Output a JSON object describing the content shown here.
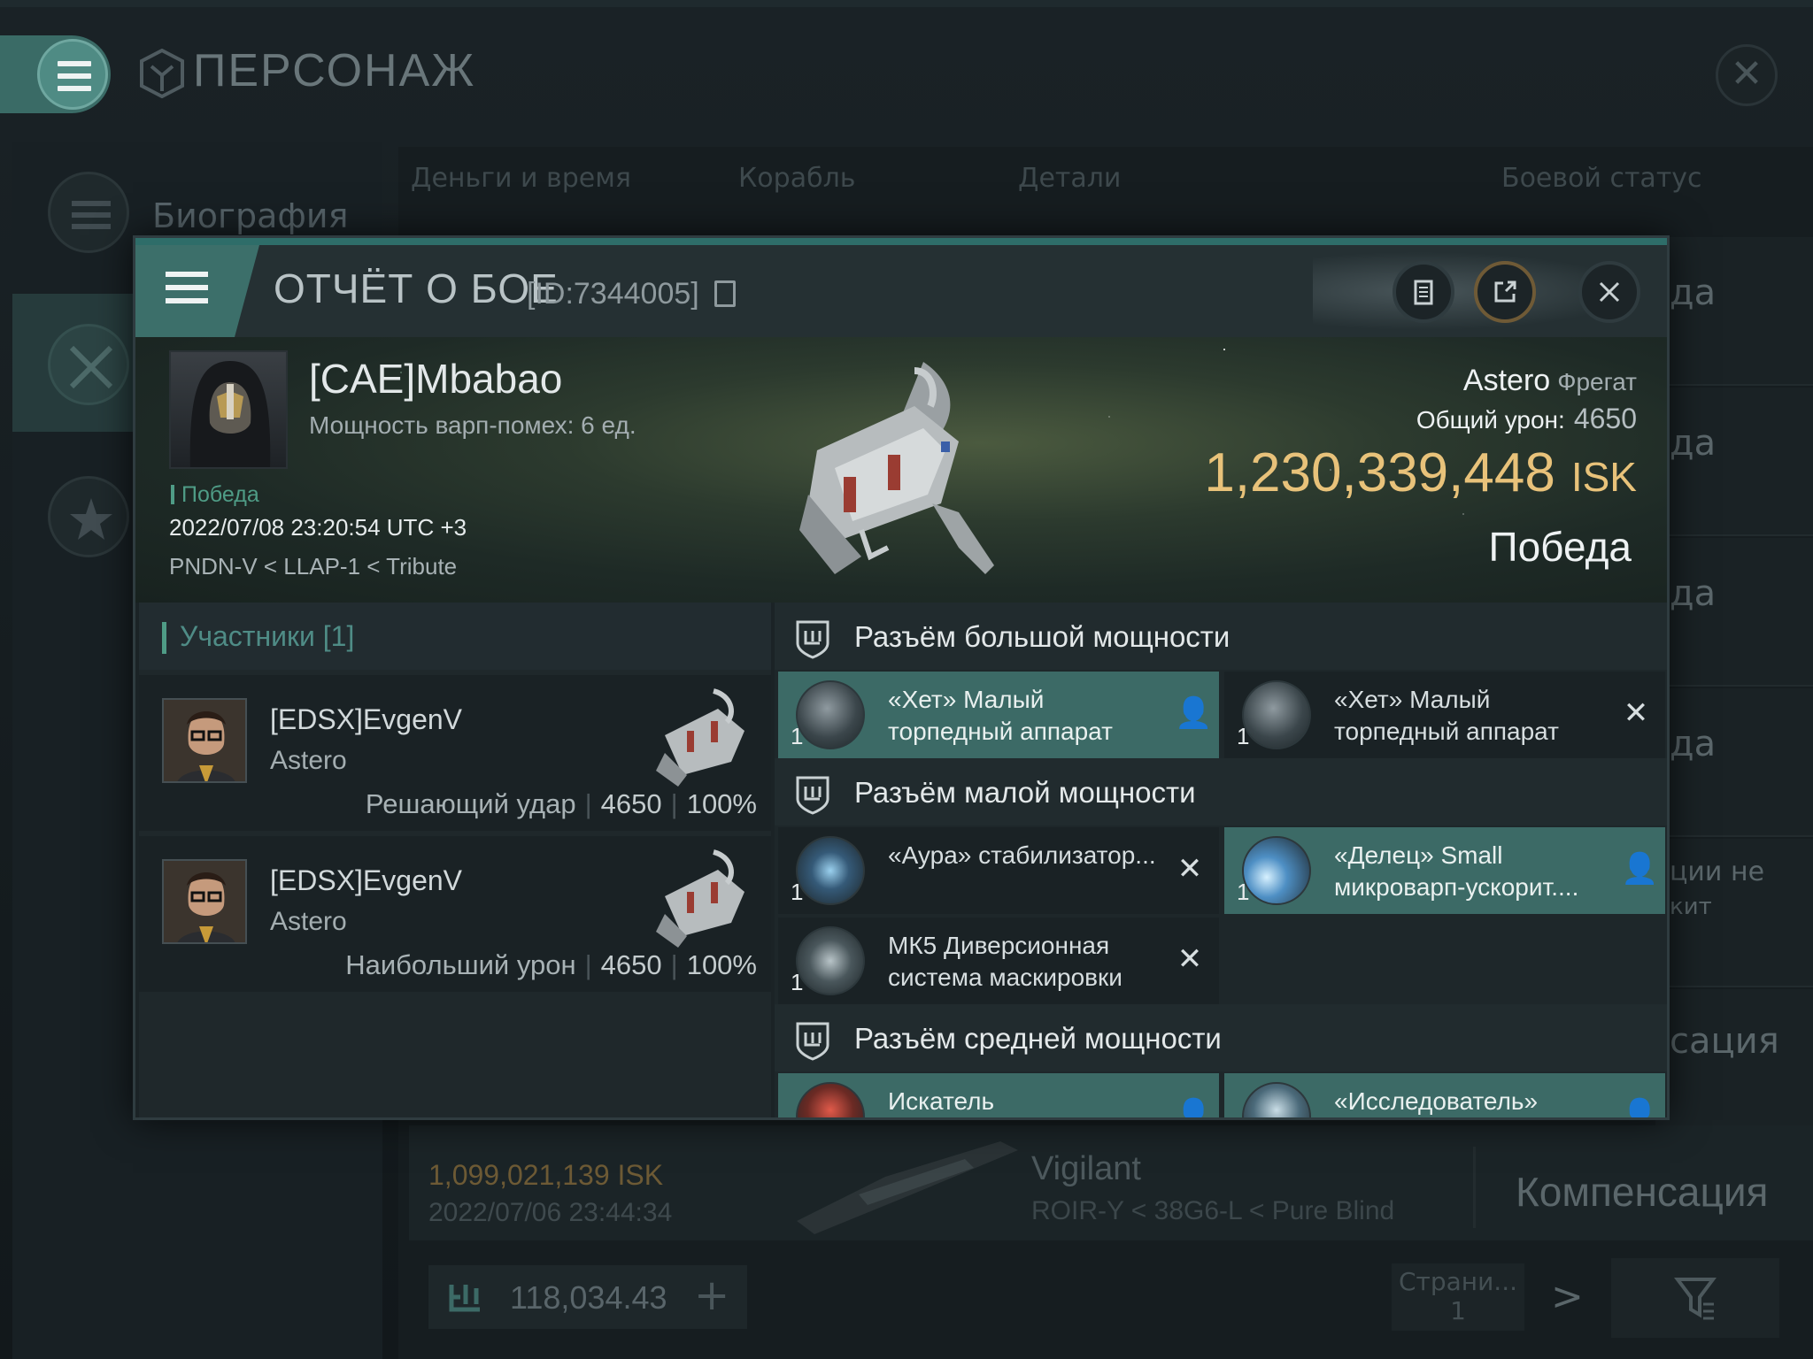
{
  "background": {
    "page_title": "ПЕРСОНАЖ",
    "sidebar": {
      "items": [
        {
          "label": "Биография",
          "icon": "list-icon",
          "active": false
        },
        {
          "label": "",
          "icon": "crossed-swords-icon",
          "active": true
        },
        {
          "label": "",
          "icon": "star-icon",
          "active": false
        }
      ]
    },
    "tabs": [
      "Деньги и время",
      "Корабль",
      "Детали",
      "Боевой статус"
    ],
    "right_fragments": [
      "да",
      "да",
      "да",
      "да",
      "ции не",
      "кит",
      "сация"
    ],
    "kill_row": {
      "isk": "1,099,021,139  ISK",
      "date": "2022/07/06  23:44:34",
      "ship": "Vigilant",
      "location": "ROIR-Y < 38G6-L < Pure Blind",
      "action": "Компенсация"
    },
    "wallet": {
      "value": "118,034.43",
      "plus": "+"
    },
    "pager": {
      "label": "Страни...",
      "page": "1",
      "next": ">"
    }
  },
  "dialog": {
    "title": "ОТЧЁТ О БОЕ",
    "id_text": "[ID:7344005]",
    "victim": {
      "name": "[CAE]Mbabao",
      "warp": "Мощность варп-помех: 6 ед.",
      "result": "Победа",
      "datetime": "2022/07/08 23:20:54 UTC +3",
      "location": "PNDN-V < LLAP-1 < Tribute"
    },
    "ship": {
      "name": "Astero",
      "class": "Фрегат",
      "damage_label": "Общий урон:",
      "damage_value": "4650",
      "isk_value": "1,230,339,448",
      "isk_unit": "ISK",
      "outcome": "Победа"
    },
    "participants": {
      "label": "Участники [1]",
      "rows": [
        {
          "name": "[EDSX]EvgenV",
          "ship": "Astero",
          "role": "Решающий удар",
          "damage": "4650",
          "percent": "100%"
        },
        {
          "name": "[EDSX]EvgenV",
          "ship": "Astero",
          "role": "Наибольший урон",
          "damage": "4650",
          "percent": "100%"
        }
      ]
    },
    "slots": {
      "high": {
        "title": "Разъём большой мощности",
        "modules": [
          {
            "qty": "1",
            "name": "«Хет» Малый торпедный аппарат",
            "state": "dropped",
            "icon": "torpedo-launcher-icon"
          },
          {
            "qty": "1",
            "name": "«Хет» Малый торпедный аппарат",
            "state": "destroyed",
            "icon": "torpedo-launcher-icon"
          }
        ]
      },
      "low": {
        "title": "Разъём малой мощности",
        "modules": [
          {
            "qty": "1",
            "name": "«Аура» стабилизатор...",
            "state": "destroyed",
            "icon": "stabilizer-icon"
          },
          {
            "qty": "1",
            "name": "«Делец» Small микроварп-ускорит....",
            "state": "dropped",
            "icon": "microwarpdrive-icon"
          },
          {
            "qty": "1",
            "name": "МК5 Диверсионная система маскировки",
            "state": "destroyed",
            "icon": "cloak-icon"
          }
        ]
      },
      "mid": {
        "title": "Разъём средней мощности",
        "modules": [
          {
            "qty": "",
            "name": "Искатель",
            "state": "dropped",
            "icon": "analyzer-icon"
          },
          {
            "qty": "",
            "name": "«Исследователь»",
            "state": "dropped",
            "icon": "scanner-icon"
          }
        ]
      }
    }
  },
  "colors": {
    "accent_teal": "#3c6a66",
    "isk_gold": "#e8c27a",
    "win_green": "#4f9c86"
  }
}
